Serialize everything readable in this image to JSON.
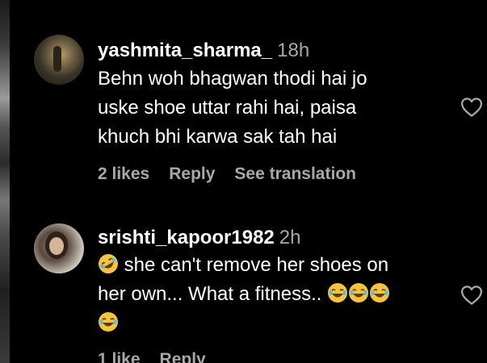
{
  "comments": [
    {
      "username": "yashmita_sharma_",
      "time": "18h",
      "lines": [
        "Behn woh bhagwan thodi hai jo",
        "uske shoe uttar rahi hai, paisa",
        "khuch bhi karwa sak tah hai"
      ],
      "likes": "2 likes",
      "reply": "Reply",
      "translation": "See translation"
    },
    {
      "username": "srishti_kapoor1982",
      "time": "2h",
      "lines": [
        " she can't remove her shoes on",
        "her own... What a fitness.. "
      ],
      "likes": "1 like",
      "reply": "Reply"
    }
  ],
  "icons": {
    "like": "heart-outline-icon",
    "rofl": "rolling-on-floor-laughing-emoji",
    "joy": "tears-of-joy-emoji"
  },
  "colors": {
    "background": "#000000",
    "text": "#ffffff",
    "secondary": "#a8a8a8"
  }
}
